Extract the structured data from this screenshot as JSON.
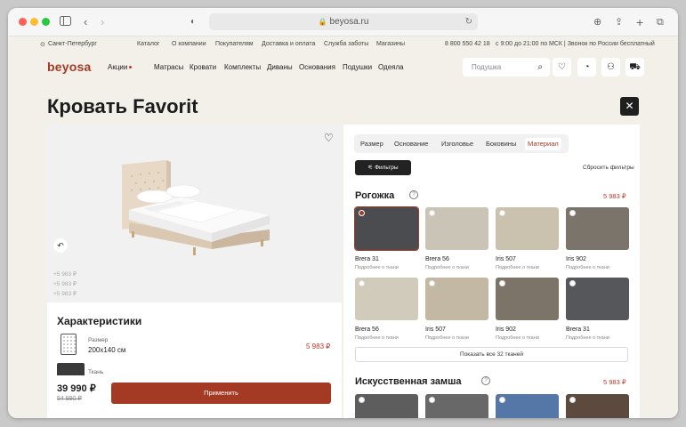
{
  "browser": {
    "url": "beyosa.ru",
    "colors": {
      "close": "#ff5f57",
      "minimize": "#febc2e",
      "zoom": "#28c840"
    }
  },
  "topbar": {
    "city": "Санкт-Петербург",
    "links": [
      "Каталог",
      "О компании",
      "Покупателям",
      "Доставка и оплата",
      "Служба заботы",
      "Магазины"
    ],
    "phone": "8 800 550 42 18",
    "hours": "с 9:00 до 21:00 по МСК | Звонок по России бесплатный"
  },
  "header": {
    "logo": "beyosa",
    "nav": [
      "Акции",
      "Матрасы",
      "Кровати",
      "Комплекты",
      "Диваны",
      "Основания",
      "Подушки",
      "Одеяла"
    ],
    "search_placeholder": "Подушка",
    "icons": [
      "search-icon",
      "heart-icon",
      "compare-icon",
      "user-icon",
      "cart-icon"
    ]
  },
  "page": {
    "title": "Кровать Favorit"
  },
  "product": {
    "ghost_prices": [
      "+5 983 ₽",
      "+5 983 ₽",
      "+5 983 ₽"
    ],
    "characteristics_title": "Характеристики",
    "size_label": "Размер",
    "size_value": "200x140 см",
    "size_price": "5 983 ₽",
    "fabric_label": "Ткань",
    "price": "39 990 ₽",
    "old_price": "54 990 ₽",
    "apply_label": "Применить"
  },
  "config": {
    "tabs": [
      "Размер",
      "Основание",
      "Изголовье",
      "Боковины",
      "Материал"
    ],
    "active_tab": "Материал",
    "filters_label": "Фильтры",
    "reset_label": "Сбросить фильтры",
    "sections": [
      {
        "title": "Рогожка",
        "price": "5 983 ₽",
        "swatches": [
          {
            "name": "Brera 31",
            "more": "Подробнее о ткани",
            "color": "#4a4c50",
            "selected": true
          },
          {
            "name": "Brera 56",
            "more": "Подробнее о ткани",
            "color": "#c9c4b6",
            "selected": false
          },
          {
            "name": "Iris 507",
            "more": "Подробнее о ткани",
            "color": "#cac2ae",
            "selected": false
          },
          {
            "name": "Iris 902",
            "more": "Подробнее о ткани",
            "color": "#7b746b",
            "selected": false
          },
          {
            "name": "Brera 56",
            "more": "Подробнее о ткани",
            "color": "#d0cbbb",
            "selected": false
          },
          {
            "name": "Iris 507",
            "more": "Подробнее о ткани",
            "color": "#c2b8a3",
            "selected": false
          },
          {
            "name": "Iris 902",
            "more": "Подробнее о ткани",
            "color": "#7d7469",
            "selected": false
          },
          {
            "name": "Brera 31",
            "more": "Подробнее о ткани",
            "color": "#55575b",
            "selected": false
          }
        ],
        "show_all": "Показать все 32 тканей"
      },
      {
        "title": "Искусственная замша",
        "price": "5 983 ₽",
        "swatches": [
          {
            "color": "#5d5d5d"
          },
          {
            "color": "#686868"
          },
          {
            "color": "#5477a8"
          },
          {
            "color": "#5b4a3d"
          }
        ]
      }
    ]
  }
}
